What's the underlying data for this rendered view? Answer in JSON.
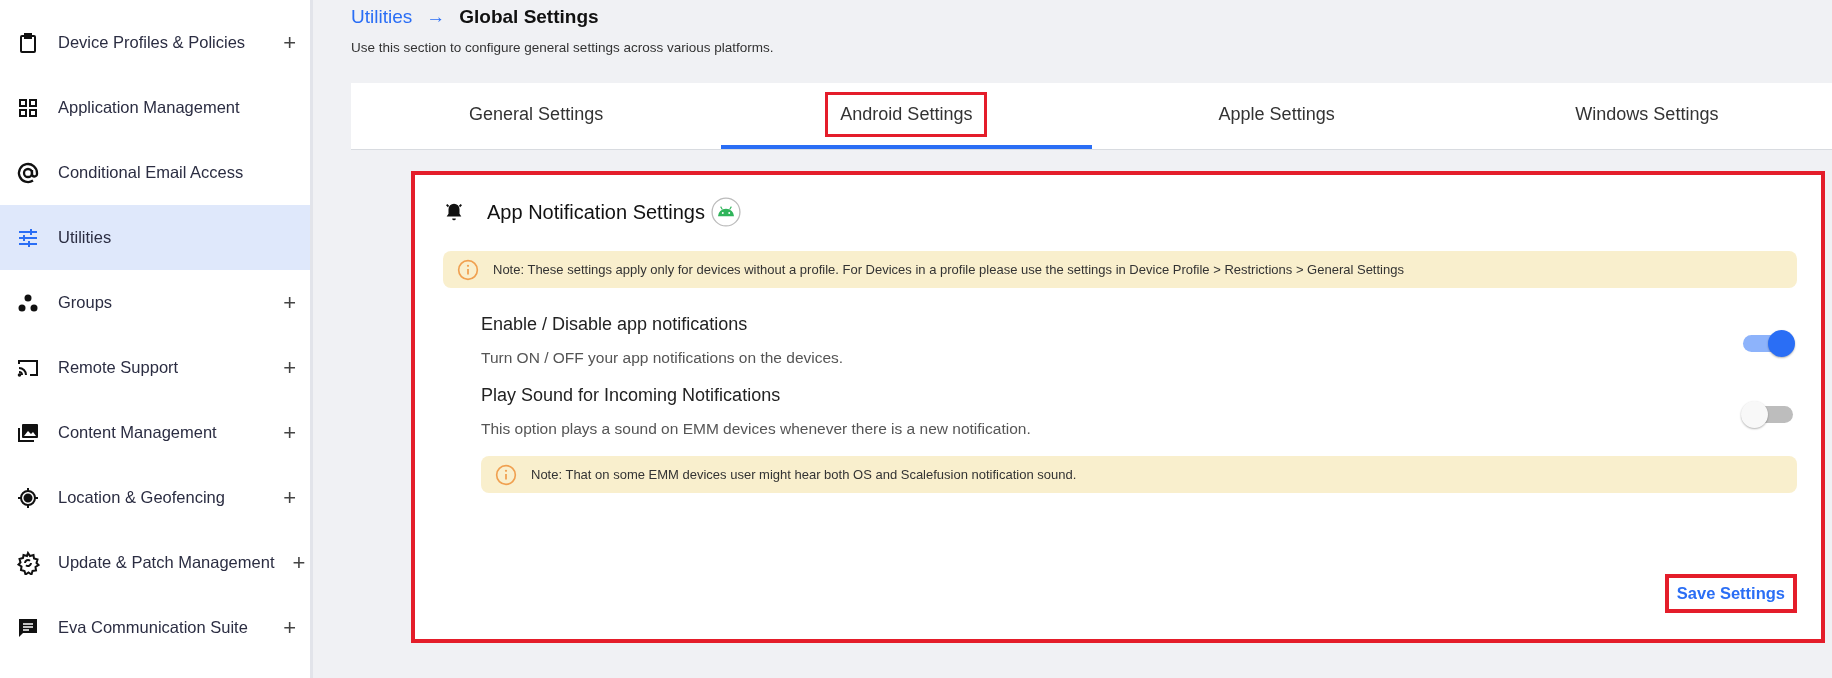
{
  "sidebar": {
    "items": [
      {
        "label": "Device Profiles & Policies",
        "expandable": true,
        "selected": false
      },
      {
        "label": "Application Management",
        "expandable": false,
        "selected": false
      },
      {
        "label": "Conditional Email Access",
        "expandable": false,
        "selected": false
      },
      {
        "label": "Utilities",
        "expandable": false,
        "selected": true
      },
      {
        "label": "Groups",
        "expandable": true,
        "selected": false
      },
      {
        "label": "Remote Support",
        "expandable": true,
        "selected": false
      },
      {
        "label": "Content Management",
        "expandable": true,
        "selected": false
      },
      {
        "label": "Location & Geofencing",
        "expandable": true,
        "selected": false
      },
      {
        "label": "Update & Patch Management",
        "expandable": true,
        "selected": false
      },
      {
        "label": "Eva Communication Suite",
        "expandable": true,
        "selected": false
      }
    ],
    "expand_symbol": "+"
  },
  "breadcrumb": {
    "parent": "Utilities",
    "separator": "→",
    "current": "Global Settings"
  },
  "description": "Use this section to configure general settings across various platforms.",
  "tabs": [
    {
      "label": "General Settings",
      "selected": false,
      "highlighted": false
    },
    {
      "label": "Android Settings",
      "selected": true,
      "highlighted": true
    },
    {
      "label": "Apple Settings",
      "selected": false,
      "highlighted": false
    },
    {
      "label": "Windows Settings",
      "selected": false,
      "highlighted": false
    }
  ],
  "card": {
    "title": "App Notification Settings",
    "highlighted": true,
    "note": "Note: These settings apply only for devices without a profile. For Devices in a profile please use the settings in Device Profile > Restrictions > General Settings",
    "settings": [
      {
        "title": "Enable / Disable app notifications",
        "description": "Turn ON / OFF your app notifications on the devices.",
        "on": true
      },
      {
        "title": "Play Sound for Incoming Notifications",
        "description": "This option plays a sound on EMM devices whenever there is a new notification.",
        "on": false
      }
    ],
    "footnote": "Note: That on some EMM devices user might hear both OS and Scalefusion notification sound.",
    "save_button": {
      "label": "Save Settings",
      "highlighted": true
    }
  }
}
